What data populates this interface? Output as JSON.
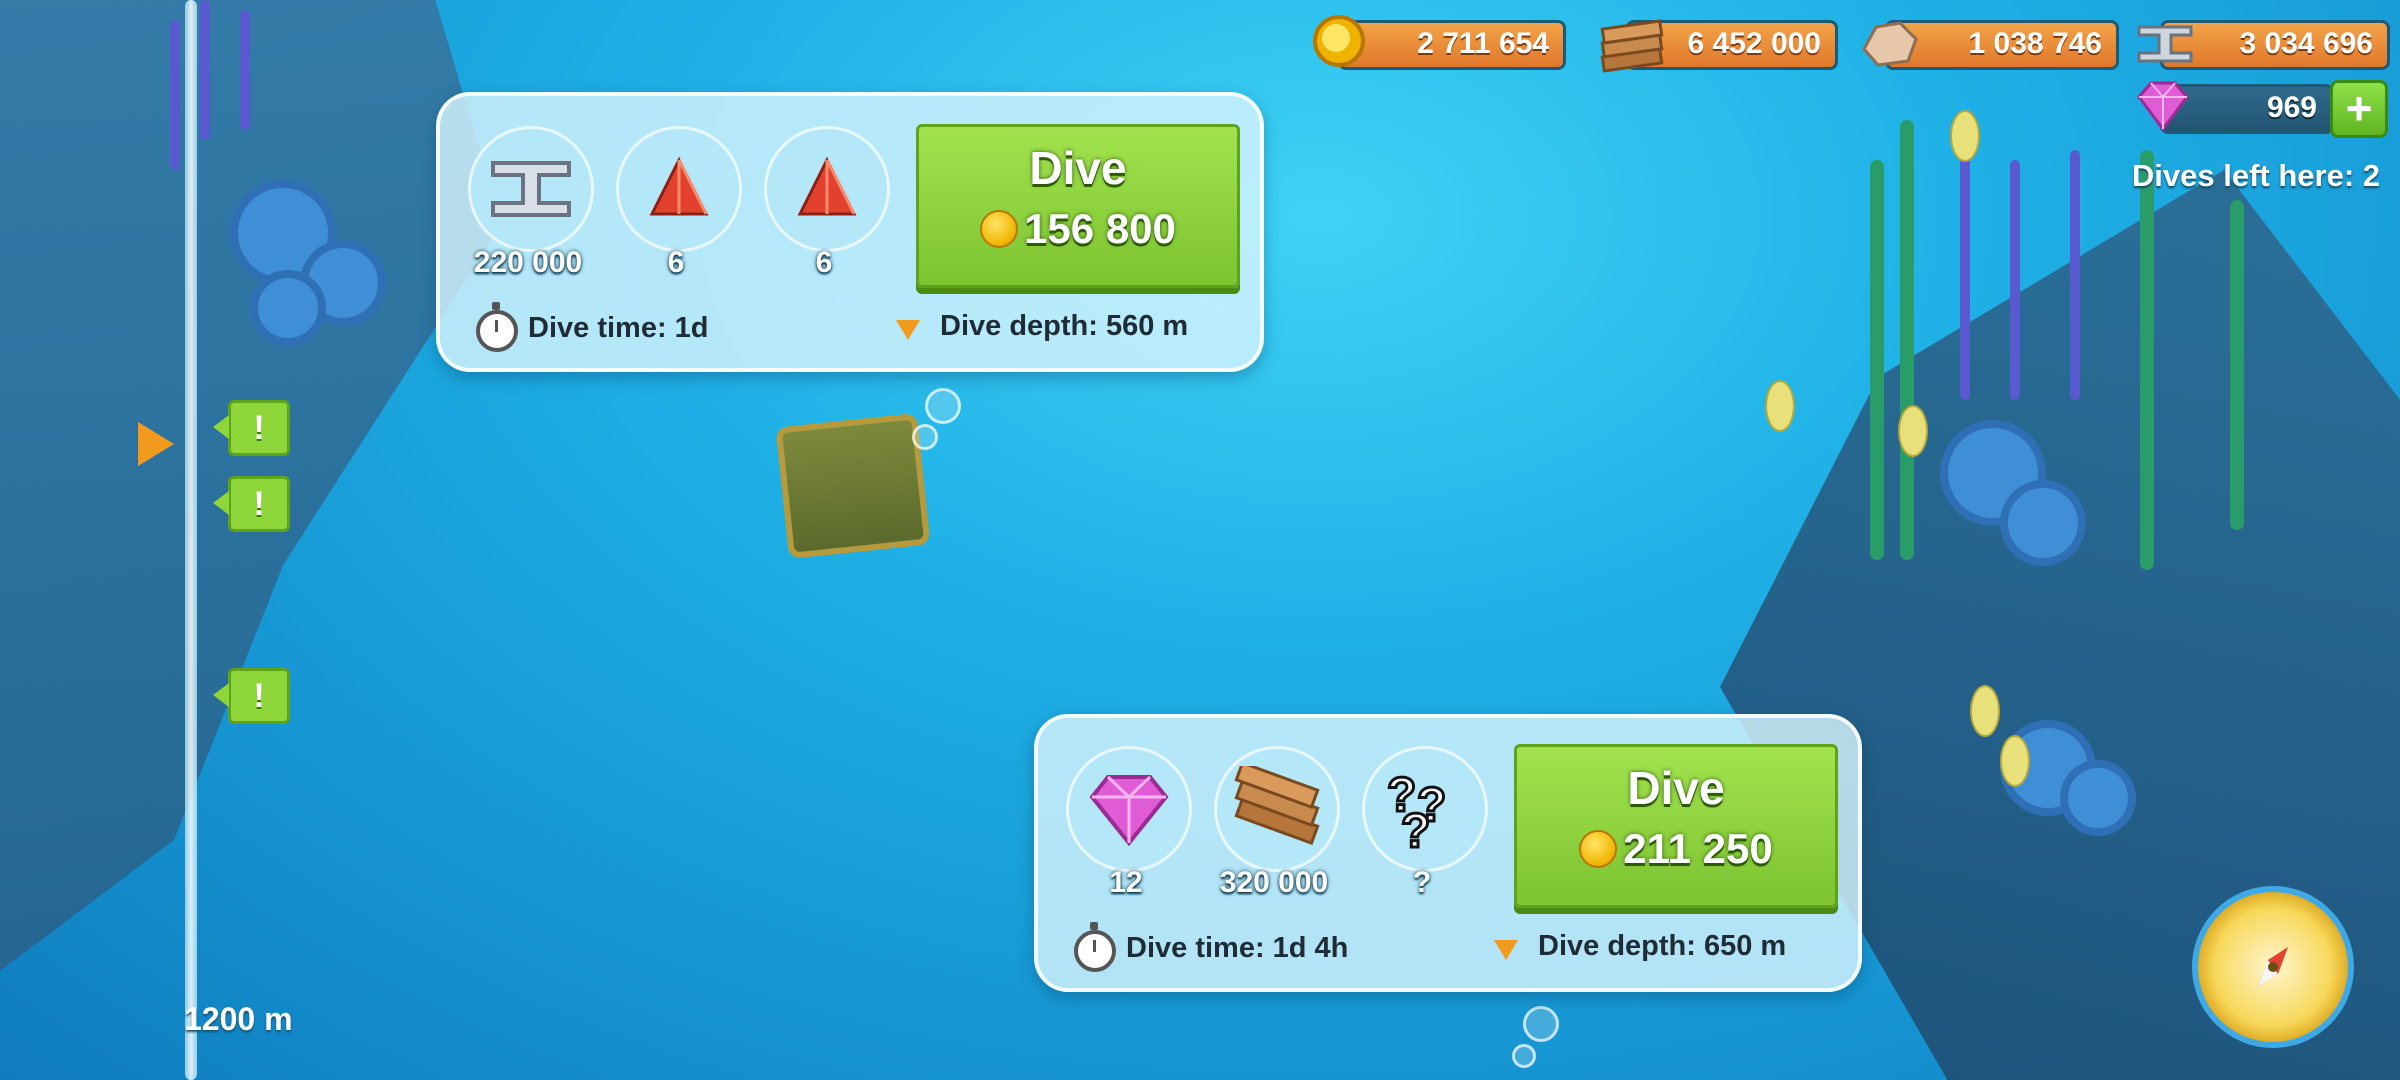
{
  "resources": {
    "coins": "2 711 654",
    "wood": "6 452 000",
    "stone": "1 038 746",
    "steel": "3 034 696",
    "gems": "969"
  },
  "dives_left": "Dives left here: 2",
  "depth_marker": "1200 m",
  "dive_panels": [
    {
      "rewards": [
        {
          "icon": "steel-beam-icon",
          "amount": "220 000"
        },
        {
          "icon": "red-pyramid-icon",
          "amount": "6"
        },
        {
          "icon": "red-pyramid-icon",
          "amount": "6"
        }
      ],
      "button_title": "Dive",
      "cost": "156 800",
      "dive_time": "Dive time: 1d",
      "dive_depth": "Dive depth: 560 m"
    },
    {
      "rewards": [
        {
          "icon": "gem-icon",
          "amount": "12"
        },
        {
          "icon": "wood-planks-icon",
          "amount": "320 000"
        },
        {
          "icon": "mystery-icon",
          "amount": "?"
        }
      ],
      "button_title": "Dive",
      "cost": "211 250",
      "dive_time": "Dive time: 1d 4h",
      "dive_depth": "Dive depth: 650 m"
    }
  ],
  "colors": {
    "resource_bar": "#e0782b",
    "dive_button": "#7dc430",
    "gauge_pointer": "#f29a1d"
  }
}
